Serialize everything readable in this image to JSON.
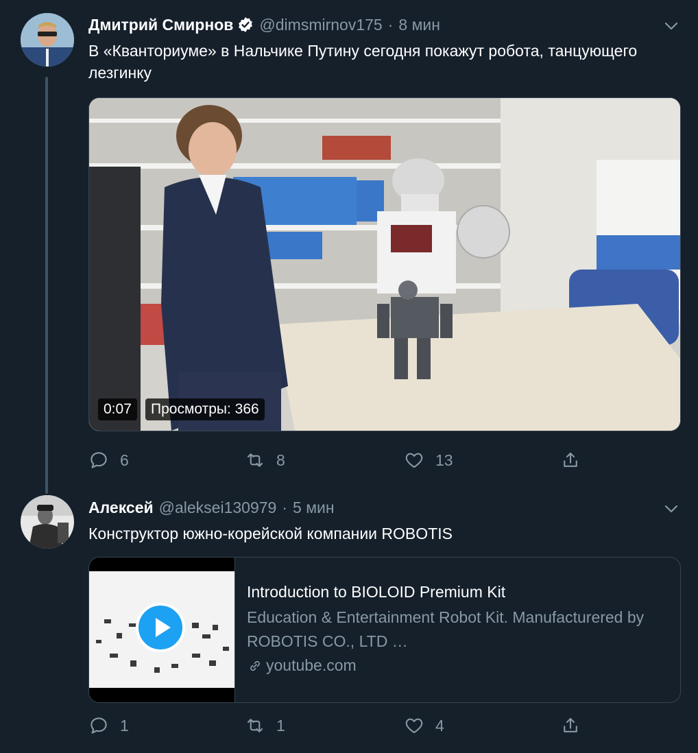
{
  "tweets": [
    {
      "name": "Дмитрий Смирнов",
      "verified": true,
      "handle": "@dimsmirnov175",
      "separator": "·",
      "time": "8 мин",
      "text": "В «Кванториуме» в Нальчике Путину сегодня покажут робота, танцующего лезгинку",
      "video": {
        "duration": "0:07",
        "views": "Просмотры: 366"
      },
      "actions": {
        "replies": "6",
        "retweets": "8",
        "likes": "13"
      }
    },
    {
      "name": "Алексей",
      "verified": false,
      "handle": "@aleksei130979",
      "separator": "·",
      "time": "5 мин",
      "text": "Конструктор южно-корейской компании ROBOTIS",
      "card": {
        "title": "Introduction to BIOLOID Premium Kit",
        "description": "Education & Entertainment Robot Kit. Manufacturered by ROBOTIS CO., LTD …",
        "domain": "youtube.com"
      },
      "actions": {
        "replies": "1",
        "retweets": "1",
        "likes": "4"
      }
    }
  ],
  "icons": {
    "verified": "verified-badge-icon",
    "menu": "chevron-down-icon",
    "reply": "reply-icon",
    "retweet": "retweet-icon",
    "like": "heart-icon",
    "share": "share-icon",
    "play": "play-icon",
    "link": "link-icon"
  },
  "colors": {
    "background": "#15202b",
    "secondary_text": "#8899a6",
    "border": "#38444d",
    "accent": "#1da1f2"
  }
}
